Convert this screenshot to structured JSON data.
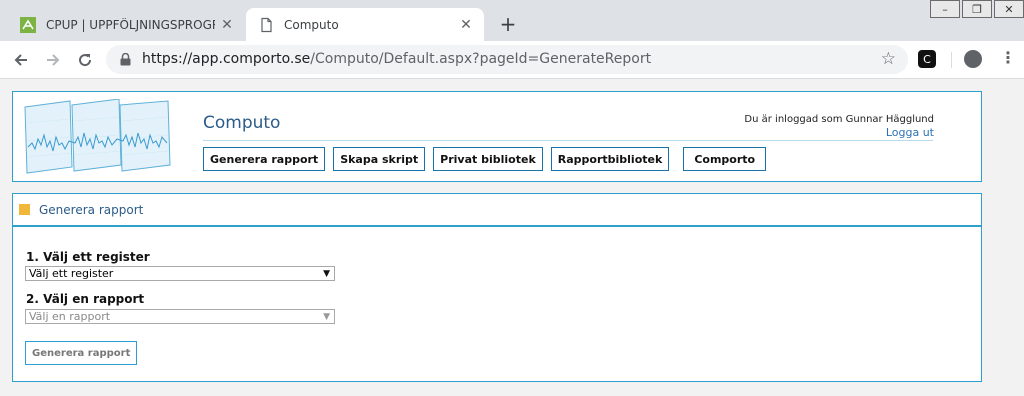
{
  "browser": {
    "tabs": [
      {
        "title": "CPUP | UPPFÖLJNINGSPROGRAM FÖ",
        "close": "✕",
        "icon": "cpup-favicon-icon"
      },
      {
        "title": "Computo",
        "close": "✕",
        "icon": "page-icon"
      }
    ],
    "new_tab": "+",
    "url_host": "https://app.comporto.se",
    "url_path": "/Computo/Default.aspx?pageId=GenerateReport",
    "extension_label": "C"
  },
  "header": {
    "app_title": "Computo",
    "logged_in_text": "Du är inloggad som Gunnar Hägglund",
    "logout": "Logga ut"
  },
  "nav": {
    "generate": "Generera rapport",
    "script": "Skapa skript",
    "private_lib": "Privat bibliotek",
    "report_lib": "Rapportbibliotek",
    "comporto": "Comporto"
  },
  "panel": {
    "title": "Generera rapport",
    "step1_label": "1. Välj ett register",
    "step1_value": "Välj ett register",
    "step2_label": "2. Välj en rapport",
    "step2_value": "Välj en rapport",
    "button": "Generera rapport"
  },
  "colors": {
    "accent": "#2e9fcf",
    "title_blue": "#2b5c8a",
    "square": "#f0b73b"
  }
}
